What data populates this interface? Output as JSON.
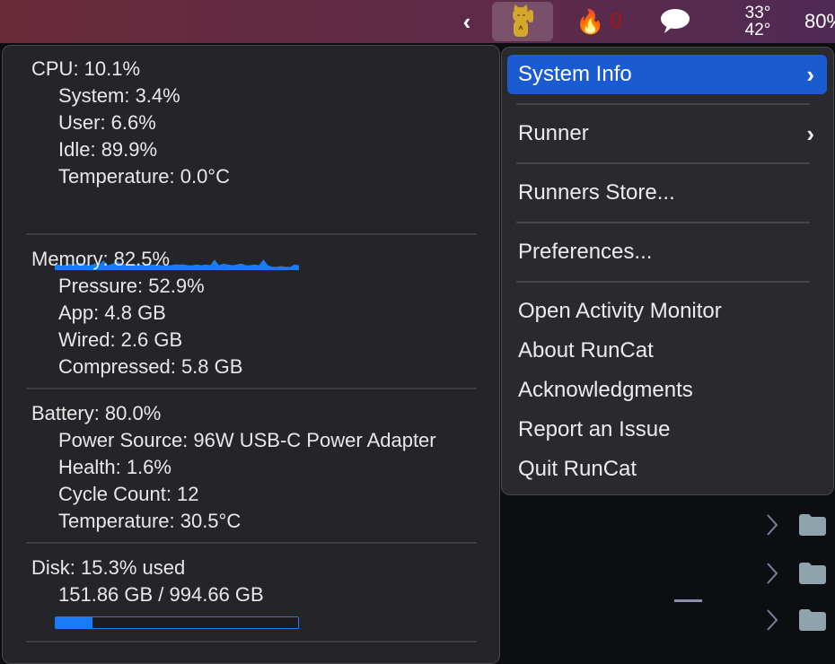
{
  "menubar": {
    "chevron": "‹",
    "cat_icon": "maneki-neko",
    "fire_icon": "🔥",
    "fire_count": "0",
    "temp_high": "33°",
    "temp_low": "42°",
    "battery": "80%"
  },
  "cpu": {
    "title": "CPU: 10.1%",
    "system": "System:  3.4%",
    "user": "User:  6.6%",
    "idle": "Idle: 89.9%",
    "temperature": "Temperature:  0.0°C",
    "history": [
      0.3,
      0.35,
      0.3,
      0.4,
      0.35,
      0.4,
      0.45,
      0.35,
      0.3,
      0.4,
      0.35,
      0.6,
      0.3,
      0.4,
      0.55,
      0.4,
      0.35,
      0.35,
      0.35,
      0.35,
      0.3,
      0.35,
      0.35,
      0.35,
      0.3,
      0.3,
      0.3,
      0.35,
      0.35,
      0.35,
      0.3,
      0.3,
      0.35,
      0.3,
      0.35,
      0.3,
      0.65,
      0.3,
      0.4,
      0.35,
      0.3,
      0.35,
      0.4,
      0.3,
      0.3,
      0.35,
      0.3,
      0.65,
      0.3,
      0.2,
      0.2,
      0.25,
      0.2,
      0.2,
      0.35,
      0.3
    ],
    "color": "#1a7cf5"
  },
  "memory": {
    "title": "Memory: 82.5%",
    "pressure": "Pressure: 52.9%",
    "app": "App:  4.8 GB",
    "wired": "Wired:  2.6 GB",
    "compressed": "Compressed:  5.8 GB"
  },
  "battery": {
    "title": "Battery:  80.0%",
    "source": "Power Source: 96W USB-C Power Adapter",
    "health": "Health:   1.6%",
    "cycles": "Cycle Count: 12",
    "temperature": "Temperature: 30.5°C"
  },
  "disk": {
    "title": "Disk: 15.3% used",
    "usage": "151.86 GB / 994.66 GB",
    "used_fraction": 0.153
  },
  "menu": {
    "items": [
      "System Info",
      "Runner",
      "Runners Store...",
      "Preferences...",
      "Open Activity Monitor",
      "About RunCat",
      "Acknowledgments",
      "Report an Issue",
      "Quit RunCat"
    ],
    "submenu_arrow": "›"
  }
}
